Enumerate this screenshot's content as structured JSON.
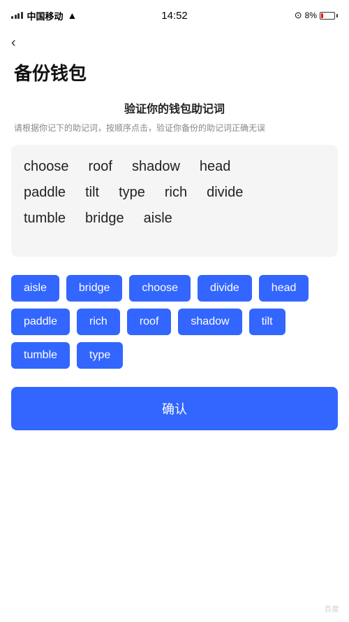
{
  "statusBar": {
    "carrier": "中国移动",
    "time": "14:52",
    "battery_percent": "8%"
  },
  "back": {
    "icon": "‹"
  },
  "page": {
    "title": "备份钱包"
  },
  "section": {
    "title": "验证你的钱包助记词",
    "description": "请根据你记下的助记词，按顺序点击，验证你备份的助记词正确无误"
  },
  "displayWords": {
    "row1": [
      "choose",
      "roof",
      "shadow",
      "head"
    ],
    "row2": [
      "paddle",
      "tilt",
      "type",
      "rich",
      "divide"
    ],
    "row3": [
      "tumble",
      "bridge",
      "aisle"
    ]
  },
  "chips": [
    "aisle",
    "bridge",
    "choose",
    "divide",
    "head",
    "paddle",
    "rich",
    "roof",
    "shadow",
    "tilt",
    "tumble",
    "type"
  ],
  "confirmButton": {
    "label": "确认"
  },
  "watermark": "百度"
}
